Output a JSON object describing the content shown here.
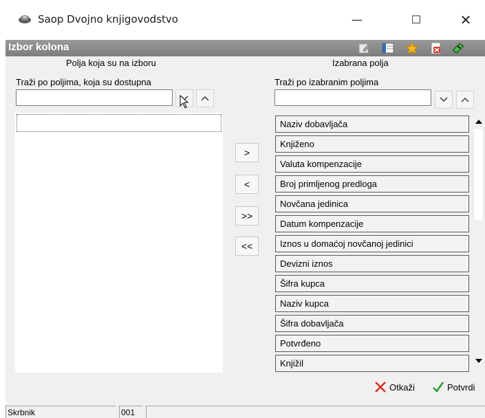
{
  "window": {
    "title": "Saop Dvojno knjigovodstvo",
    "minimize": "—",
    "maximize": "☐",
    "close": "✕"
  },
  "dialog": {
    "title": "Izbor kolona",
    "toolbar_icons": [
      "edit-icon",
      "columns-icon",
      "star-icon",
      "delete-icon",
      "book-icon"
    ]
  },
  "left": {
    "heading": "Polja koja su na izboru",
    "search_label": "Traži po poljima, koja su dostupna",
    "search_value": ""
  },
  "right": {
    "heading": "Izabrana polja",
    "search_label": "Traži po izabranim poljima",
    "search_value": "",
    "items": [
      "Naziv dobavljača",
      "Knjiženo",
      "Valuta kompenzacije",
      "Broj primljenog predloga",
      "Novčana jedinica",
      "Datum kompenzacije",
      "Iznos u domaćoj novčanoj jedinici",
      "Devizni iznos",
      "Šifra kupca",
      "Naziv kupca",
      "Šifra dobavljača",
      "Potvrđeno",
      "Knjižil"
    ]
  },
  "move_buttons": [
    ">",
    "<",
    ">>",
    "<<"
  ],
  "footer": {
    "cancel_label": "Otkaži",
    "confirm_label": "Potvrdi",
    "cancel_color": "#d52b1e",
    "confirm_color": "#2e9c2e"
  },
  "status": {
    "cell1": "Skrbnik",
    "cell2": "001",
    "cell3": ""
  }
}
